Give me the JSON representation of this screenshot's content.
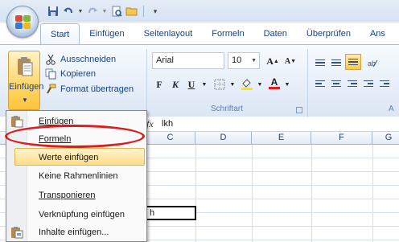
{
  "title_bar": {
    "quick_access": [
      "save-icon",
      "undo-icon",
      "redo-icon",
      "print-preview-icon",
      "open-icon",
      "customize-icon"
    ]
  },
  "tabs": [
    "Start",
    "Einfügen",
    "Seitenlayout",
    "Formeln",
    "Daten",
    "Überprüfen",
    "Ans"
  ],
  "active_tab": "Start",
  "ribbon": {
    "clipboard": {
      "paste_label": "Einfügen",
      "cut_label": "Ausschneiden",
      "copy_label": "Kopieren",
      "format_painter_label": "Format übertragen"
    },
    "font": {
      "name": "Arial",
      "size": "10",
      "group_label": "Schriftart",
      "bold": "F",
      "italic": "K",
      "underline": "U",
      "grow": "A",
      "shrink": "A",
      "font_color": "A"
    },
    "alignment": {
      "group_label": "A"
    }
  },
  "formula_bar": {
    "fx": "fx",
    "value": "lkh"
  },
  "columns": [
    "C",
    "D",
    "E",
    "F",
    "G"
  ],
  "active_cell_value": "h",
  "paste_menu": {
    "items": [
      {
        "label": "Einfügen",
        "icon": "paste-icon"
      },
      {
        "label": "Formeln",
        "icon": ""
      },
      {
        "label": "Werte einfügen",
        "icon": ""
      },
      {
        "label": "Keine Rahmenlinien",
        "icon": ""
      },
      {
        "label": "Transponieren",
        "icon": ""
      },
      {
        "label": "Verknüpfung einfügen",
        "icon": ""
      },
      {
        "label": "Inhalte einfügen...",
        "icon": "paste-special-icon"
      }
    ],
    "highlighted_index": 2
  },
  "colors": {
    "accent": "#15428b",
    "highlight_ring": "#d81e1e",
    "menu_hover": "#ffdd88"
  }
}
